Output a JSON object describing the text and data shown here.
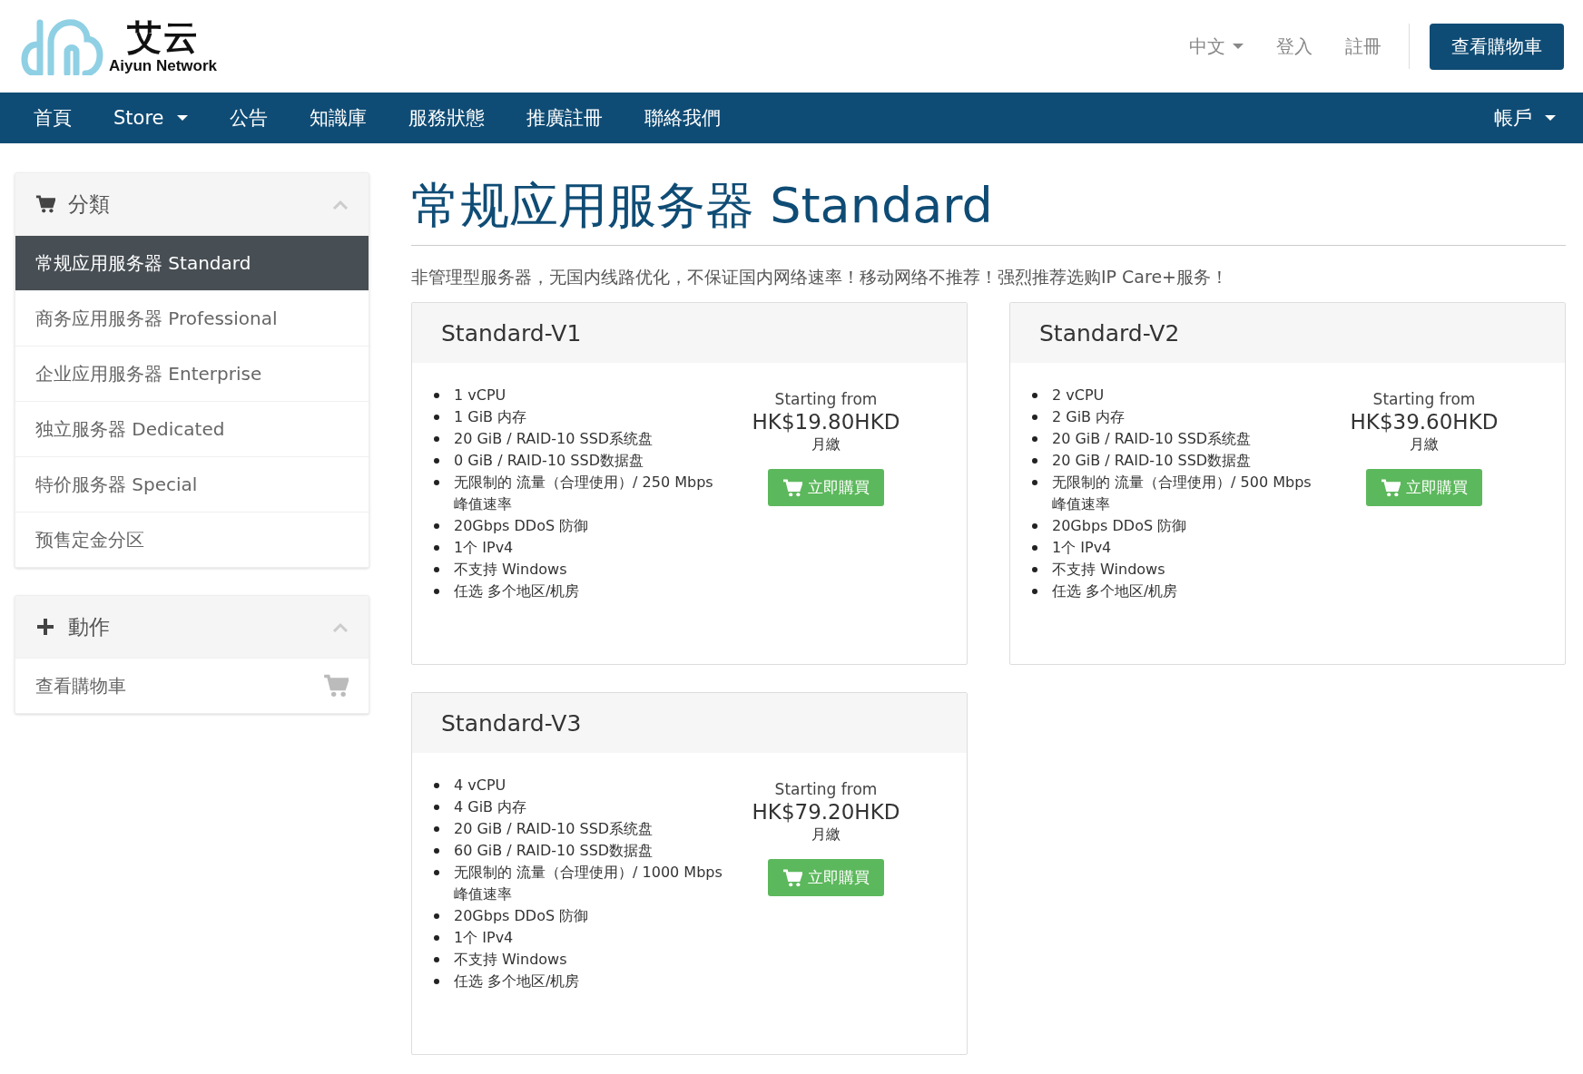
{
  "header": {
    "logo_title": "艾云",
    "logo_subtitle": "Aiyun Network",
    "links": [
      {
        "label": "中文",
        "kind": "dropdown"
      },
      {
        "label": "登入",
        "kind": "link"
      },
      {
        "label": "註冊",
        "kind": "link"
      }
    ],
    "cart_button": "查看購物車"
  },
  "nav": {
    "items": [
      {
        "label": "首頁",
        "kind": "link"
      },
      {
        "label": "Store",
        "kind": "dropdown"
      },
      {
        "label": "公告",
        "kind": "link"
      },
      {
        "label": "知識庫",
        "kind": "link"
      },
      {
        "label": "服務狀態",
        "kind": "link"
      },
      {
        "label": "推廣註冊",
        "kind": "link"
      },
      {
        "label": "聯絡我們",
        "kind": "link"
      }
    ],
    "account": {
      "label": "帳戶",
      "kind": "dropdown"
    }
  },
  "sidebar": {
    "panels": [
      {
        "title": "分類",
        "kind": "cart",
        "items": [
          {
            "label": "常规应用服务器 Standard",
            "selected": true
          },
          {
            "label": "商务应用服务器 Professional",
            "selected": false
          },
          {
            "label": "企业应用服务器 Enterprise",
            "selected": false
          },
          {
            "label": "独立服务器 Dedicated",
            "selected": false
          },
          {
            "label": "特价服务器 Special",
            "selected": false
          },
          {
            "label": "预售定金分区",
            "selected": false
          }
        ]
      },
      {
        "title": "動作",
        "kind": "plus",
        "items": [
          {
            "label": "查看購物車",
            "selected": false,
            "kind": "cart"
          }
        ]
      }
    ]
  },
  "main": {
    "title": "常规应用服务器 Standard",
    "description": "非管理型服务器，无国内线路优化，不保证国内网络速率！移动网络不推荐！强烈推荐选购IP Care+服务！",
    "products": [
      {
        "name": "Standard-V1",
        "features": [
          "1 vCPU",
          "1 GiB 内存",
          "20 GiB / RAID-10 SSD系统盘",
          "0 GiB / RAID-10 SSD数据盘",
          "无限制的 流量（合理使用）/ 250 Mbps 峰值速率",
          "20Gbps DDoS 防御",
          "1个 IPv4",
          "不支持 Windows",
          "任选 多个地区/机房"
        ],
        "price_label": "Starting from",
        "price": "HK$19.80HKD",
        "cycle": "月繳",
        "button": "立即購買"
      },
      {
        "name": "Standard-V2",
        "features": [
          "2 vCPU",
          "2 GiB 内存",
          "20 GiB / RAID-10 SSD系统盘",
          "20 GiB / RAID-10 SSD数据盘",
          "无限制的 流量（合理使用）/ 500 Mbps 峰值速率",
          "20Gbps DDoS 防御",
          "1个 IPv4",
          "不支持 Windows",
          "任选 多个地区/机房"
        ],
        "price_label": "Starting from",
        "price": "HK$39.60HKD",
        "cycle": "月繳",
        "button": "立即購買"
      },
      {
        "name": "Standard-V3",
        "features": [
          "4 vCPU",
          "4 GiB 内存",
          "20 GiB / RAID-10 SSD系统盘",
          "60 GiB / RAID-10 SSD数据盘",
          "无限制的 流量（合理使用）/ 1000 Mbps 峰值速率",
          "20Gbps DDoS 防御",
          "1个 IPv4",
          "不支持 Windows",
          "任选 多个地区/机房"
        ],
        "price_label": "Starting from",
        "price": "HK$79.20HKD",
        "cycle": "月繳",
        "button": "立即購買"
      }
    ]
  }
}
